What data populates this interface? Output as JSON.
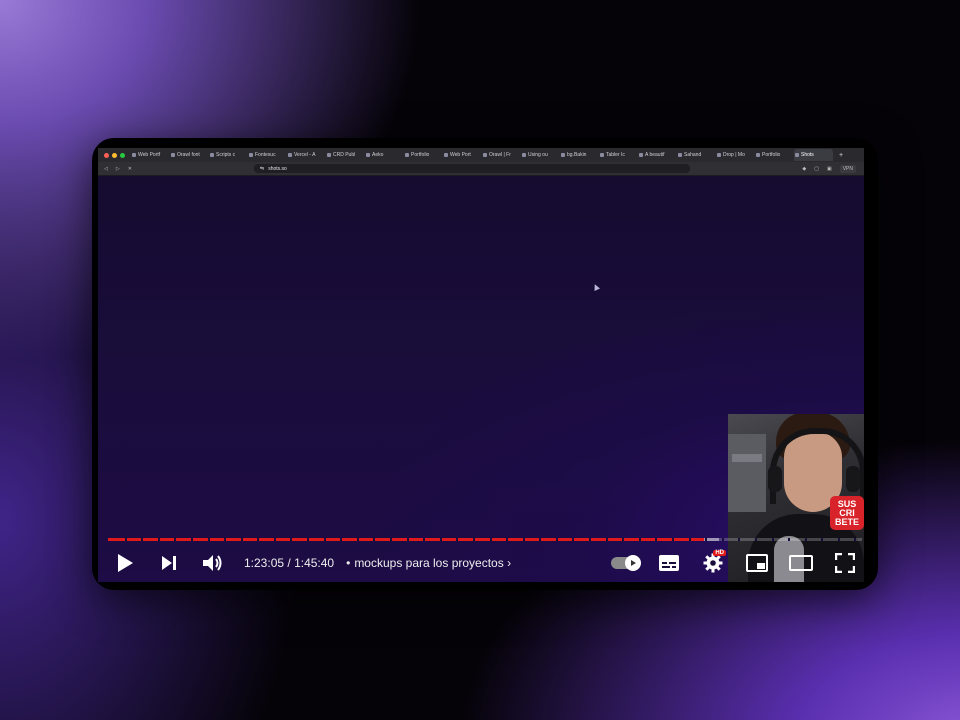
{
  "browser": {
    "tabs": [
      {
        "label": "Web Portf"
      },
      {
        "label": "Orawl font"
      },
      {
        "label": "Scripts c"
      },
      {
        "label": "Fontesuc"
      },
      {
        "label": "Vercel - A"
      },
      {
        "label": "CRD Publ"
      },
      {
        "label": "Aeko"
      },
      {
        "label": "Portfolio"
      },
      {
        "label": "Web Port"
      },
      {
        "label": "Orawl | Fr"
      },
      {
        "label": "Using ou"
      },
      {
        "label": "bg.Bakin"
      },
      {
        "label": "Tabler Ic"
      },
      {
        "label": "A beautif"
      },
      {
        "label": "Sahand"
      },
      {
        "label": "Drop | Mo"
      },
      {
        "label": "Portfolio"
      },
      {
        "label": "Shots"
      }
    ],
    "active_tab_index": 17,
    "new_tab_label": "+",
    "url": "shots.so",
    "vpn_label": "VPN"
  },
  "webcam": {
    "badge_line1": "SUS",
    "badge_line2": "CRI",
    "badge_line3": "BETE"
  },
  "player": {
    "played_fraction": 0.791,
    "loaded_fraction": 0.81,
    "time_current": "1:23:05",
    "time_total": "1:45:40",
    "time_sep": " / ",
    "chapter_sep": "•",
    "chapter_title": "mockups para los proyectos",
    "chapter_arrow": "›",
    "hd_badge": "HD",
    "icons": {
      "play": "play-icon",
      "next": "next-icon",
      "volume": "volume-icon",
      "autoplay": "autoplay-toggle-icon",
      "subtitles": "subtitles-icon",
      "settings": "gear-icon",
      "miniplayer": "miniplayer-icon",
      "theater": "theater-mode-icon",
      "fullscreen": "fullscreen-icon"
    },
    "accent_color": "#e01a1a"
  }
}
